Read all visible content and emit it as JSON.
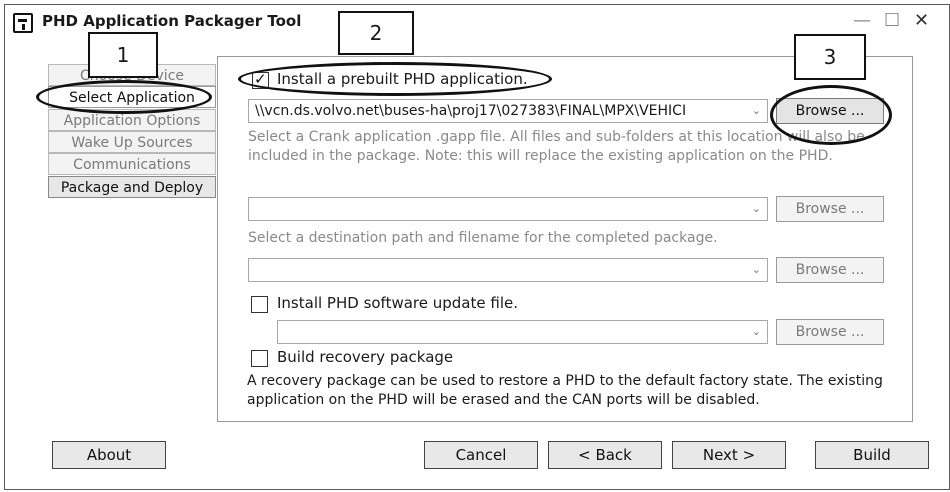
{
  "window": {
    "title": "PHD Application Packager Tool",
    "minimize": "—",
    "maximize": "☐",
    "close": "✕"
  },
  "sidebar": {
    "items": [
      {
        "label": "Choose Device"
      },
      {
        "label": "Select Application"
      },
      {
        "label": "Application Options"
      },
      {
        "label": "Wake Up Sources"
      },
      {
        "label": "Communications"
      },
      {
        "label": "Package and Deploy"
      }
    ]
  },
  "main": {
    "install_prebuilt_label": "Install a prebuilt PHD application.",
    "install_prebuilt_checked": true,
    "app_path_value": "\\\\vcn.ds.volvo.net\\buses-ha\\proj17\\027383\\FINAL\\MPX\\VEHICI",
    "app_help": "Select a Crank application .gapp file. All files and sub-folders at this location will also be included in the package. Note: this will replace the existing application on the PHD.",
    "dest_path_value": "",
    "dest_help": "Select a destination path and filename for the completed package.",
    "third_path_value": "",
    "install_update_label": "Install PHD software update file.",
    "update_path_value": "",
    "build_recovery_label": "Build recovery package",
    "recovery_help": "A recovery package can be used to restore a PHD to the default factory state. The existing application on the PHD will be erased and the CAN ports will be disabled.",
    "browse_label": "Browse ...",
    "dropdown_arrow": "⌄"
  },
  "footer": {
    "about": "About",
    "cancel": "Cancel",
    "back": "< Back",
    "next": "Next >",
    "build": "Build"
  },
  "annotations": {
    "one": "1",
    "two": "2",
    "three": "3"
  }
}
